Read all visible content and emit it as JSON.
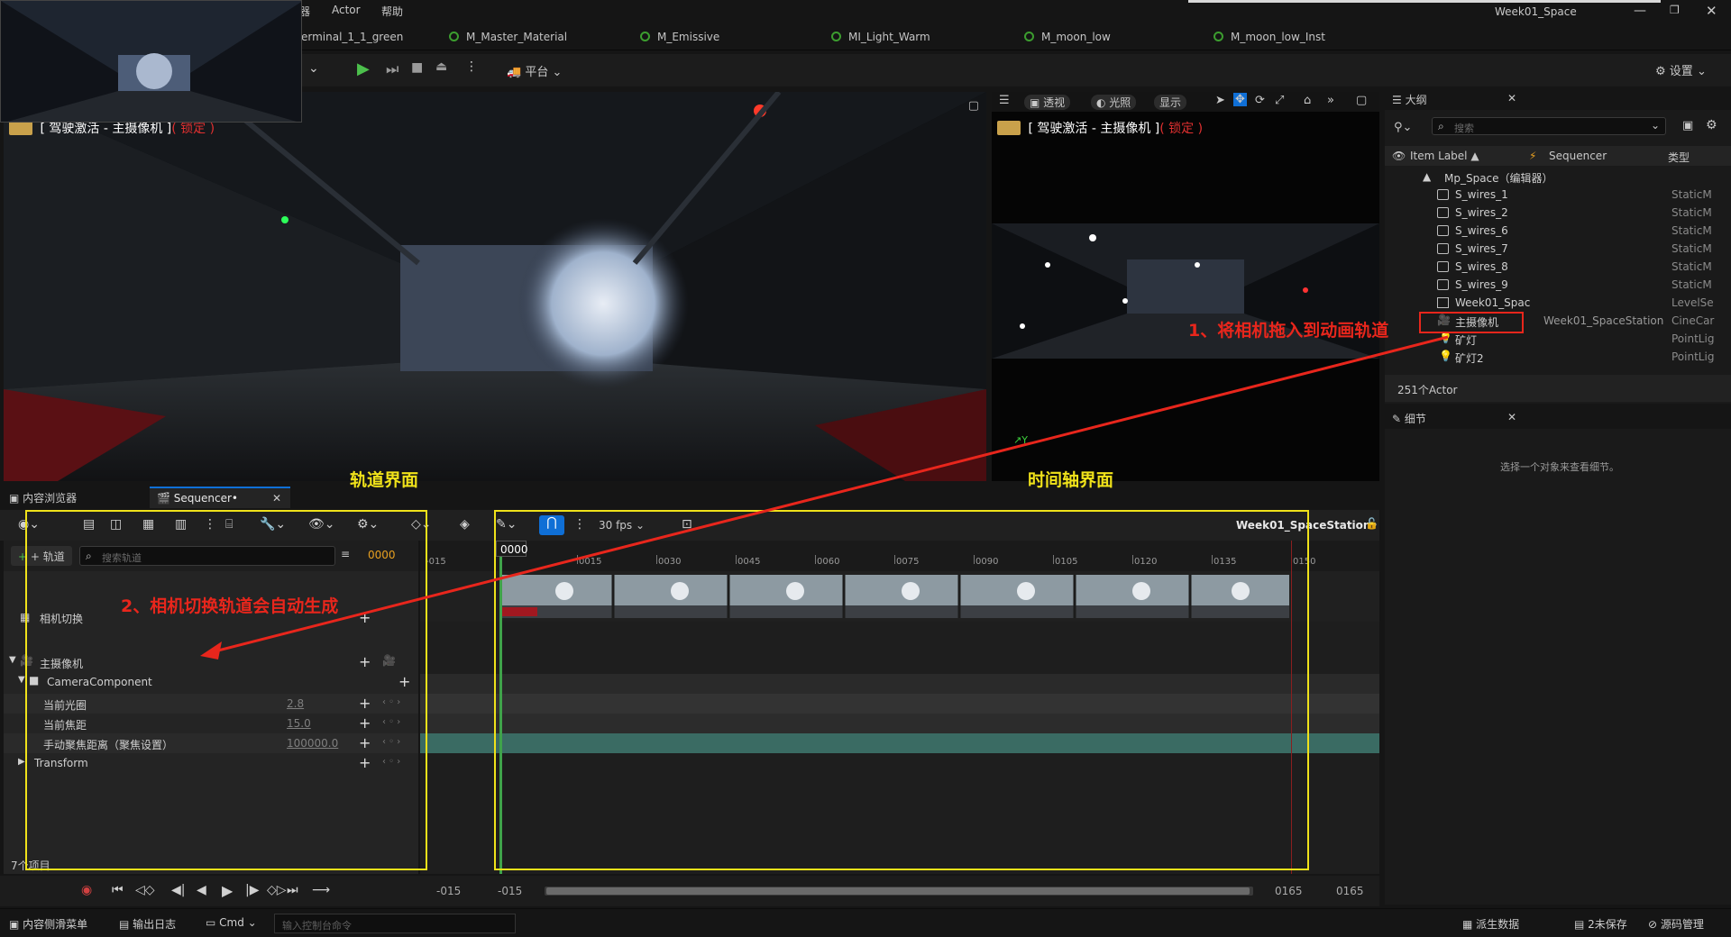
{
  "menu": {
    "items": [
      "器",
      "Actor",
      "帮助"
    ],
    "window_title": "Week01_Space"
  },
  "asset_tabs": [
    "erminal_1_1_green",
    "M_Master_Material",
    "M_Emissive",
    "MI_Light_Warm",
    "M_moon_low",
    "M_moon_low_Inst"
  ],
  "toolbar": {
    "platform_label": "平台",
    "settings_label": "设置"
  },
  "viewport_left": {
    "label": "[ 驾驶激活 - 主摄像机 ]",
    "lock": "( 锁定 )"
  },
  "viewport_right": {
    "label": "[ 驾驶激活 - 主摄像机 ]",
    "lock": "( 锁定 )",
    "perspective": "透视",
    "lit": "光照",
    "show": "显示"
  },
  "outliner": {
    "tab_title": "大纲",
    "search_placeholder": "搜索",
    "columns": {
      "item_label": "Item Label ▲",
      "sequencer": "Sequencer",
      "type": "类型"
    },
    "root": "Mp_Space（编辑器）",
    "rows": [
      {
        "name": "S_wires_1",
        "type": "StaticM"
      },
      {
        "name": "S_wires_2",
        "type": "StaticM"
      },
      {
        "name": "S_wires_6",
        "type": "StaticM"
      },
      {
        "name": "S_wires_7",
        "type": "StaticM"
      },
      {
        "name": "S_wires_8",
        "type": "StaticM"
      },
      {
        "name": "S_wires_9",
        "type": "StaticM"
      },
      {
        "name": "Week01_Spac",
        "type": "LevelSe"
      },
      {
        "name": "主摄像机",
        "sequencer": "Week01_SpaceStation",
        "type": "CineCar"
      },
      {
        "name": "矿灯",
        "type": "PointLig"
      },
      {
        "name": "矿灯2",
        "type": "PointLig"
      }
    ],
    "count": "251个Actor"
  },
  "details": {
    "tab_title": "细节",
    "empty_text": "选择一个对象来查看细节。"
  },
  "bottom_tabs": {
    "content_browser": "内容浏览器",
    "sequencer": "Sequencer•"
  },
  "sequencer": {
    "fps": "30 fps",
    "sequence_name": "Week01_SpaceStation•",
    "add_track": "+ 轨道",
    "search_placeholder": "搜索轨道",
    "current_frame": "0000",
    "playhead_frame": "0000",
    "tracks": [
      {
        "label": "相机切换"
      },
      {
        "label": "主摄像机"
      },
      {
        "label": "CameraComponent"
      },
      {
        "label": "当前光圈",
        "value": "2.8"
      },
      {
        "label": "当前焦距",
        "value": "15.0"
      },
      {
        "label": "手动聚焦距离（聚焦设置）",
        "value": "100000.0"
      },
      {
        "label": "Transform"
      }
    ],
    "item_count": "7个项目",
    "ruler": [
      "-015",
      "0015",
      "0030",
      "0045",
      "0060",
      "0075",
      "0090",
      "0105",
      "0120",
      "0135",
      "0150"
    ],
    "range": {
      "start_outer": "-015",
      "start_inner": "-015",
      "end_inner": "0165",
      "end_outer": "0165"
    }
  },
  "annotations": {
    "track_ui": "轨道界面",
    "timeline_ui": "时间轴界面",
    "step1": "1、将相机拖入到动画轨道",
    "step2": "2、相机切换轨道会自动生成"
  },
  "statusbar": {
    "content_drawer": "内容侧滑菜单",
    "output_log": "输出日志",
    "cmd": "Cmd",
    "console_placeholder": "输入控制台命令",
    "derived_data": "派生数据",
    "unsaved": "2未保存",
    "source_control": "源码管理"
  },
  "colors": {
    "accent": "#0f6fd6",
    "annotation_yellow": "#f0e21a",
    "annotation_red": "#e8261c",
    "lock_red": "#e03030",
    "track_teal": "#3a6b63"
  }
}
